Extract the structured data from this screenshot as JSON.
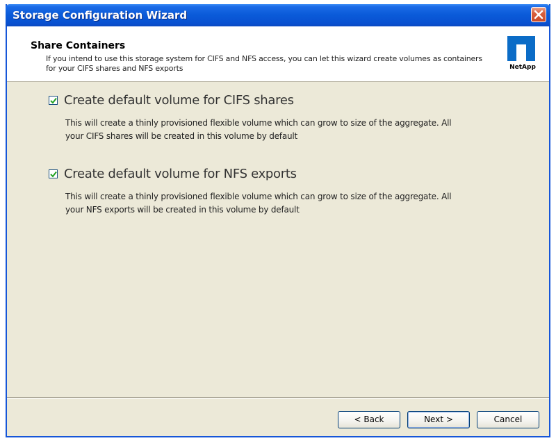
{
  "window": {
    "title": "Storage Configuration Wizard"
  },
  "header": {
    "title": "Share Containers",
    "description": "If you intend to use this storage system for CIFS and NFS access, you can let this wizard create volumes as containers for your CIFS shares and NFS exports",
    "logo_text": "NetApp"
  },
  "options": [
    {
      "label": "Create default volume for CIFS shares",
      "checked": true,
      "description": "This will create a thinly provisioned flexible volume which can grow to size of the aggregate. All your CIFS shares will be created in this volume by default"
    },
    {
      "label": "Create default volume for NFS exports",
      "checked": true,
      "description": "This will create a thinly provisioned flexible volume which can grow to size of the aggregate. All your NFS exports will be created in this volume by default"
    }
  ],
  "buttons": {
    "back": "< Back",
    "next": "Next >",
    "cancel": "Cancel"
  },
  "colors": {
    "titlebar": "#0a5ad8",
    "dialog_bg": "#ece9d8",
    "checkmark": "#21a121",
    "logo": "#0b6cc7"
  }
}
